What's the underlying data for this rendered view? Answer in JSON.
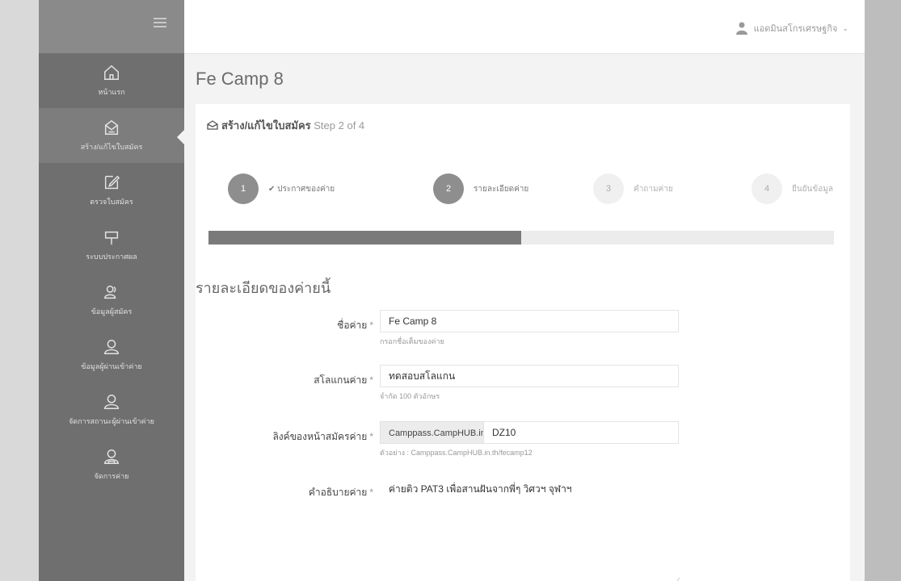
{
  "sidebar": {
    "items": [
      {
        "label": "หน้าแรก",
        "icon": "home-icon"
      },
      {
        "label": "สร้าง/แก้ไขใบสมัคร",
        "icon": "form-icon"
      },
      {
        "label": "ตรวจใบสมัคร",
        "icon": "edit-icon"
      },
      {
        "label": "ระบบประกาศผล",
        "icon": "signpost-icon"
      },
      {
        "label": "ข้อมูลผู้สมัคร",
        "icon": "users-icon"
      },
      {
        "label": "ข้อมูลผู้ผ่านเข้าค่าย",
        "icon": "user-icon"
      },
      {
        "label": "จัดการสถานะผู้ผ่านเข้าค่าย",
        "icon": "user-manage-icon"
      },
      {
        "label": "จัดการค่าย",
        "icon": "camp-icon"
      }
    ]
  },
  "topbar": {
    "user_name": "แอดมินสโกรเศรษฐกิจ"
  },
  "page": {
    "title": "Fe Camp 8"
  },
  "panel": {
    "title": "สร้าง/แก้ไขใบสมัคร",
    "step_text": "Step 2 of 4"
  },
  "wizard": {
    "steps": [
      {
        "number": "1",
        "label": "✔ ประกาศของค่าย",
        "state": "done"
      },
      {
        "number": "2",
        "label": "รายละเอียดค่าย",
        "state": "current"
      },
      {
        "number": "3",
        "label": "คำถามค่าย",
        "state": "todo"
      },
      {
        "number": "4",
        "label": "ยืนยันข้อมูล",
        "state": "todo"
      }
    ],
    "progress_fraction": 0.5
  },
  "form": {
    "section_title": "รายละเอียดของค่ายนี้",
    "camp_name": {
      "label": "ชื่อค่าย",
      "value": "Fe Camp 8",
      "help": "กรอกชื่อเต็มของค่าย"
    },
    "slogan": {
      "label": "สโลแกนค่าย",
      "value": "ทดสอบสโลแกน",
      "help": "จำกัด 100 ตัวอักษร"
    },
    "link": {
      "label": "ลิงค์ของหน้าสมัครค่าย",
      "prefix": "Camppass.CampHUB.in.th/",
      "value": "DZ10",
      "help": "ตัวอย่าง : Camppass.CampHUB.in.th/fecamp12"
    },
    "description": {
      "label": "คำอธิบายค่าย",
      "value": "ค่ายติว PAT3 เพื่อสานฝันจากพี่ๆ วิศวฯ จุฬาฯ"
    },
    "required_mark": "*"
  }
}
